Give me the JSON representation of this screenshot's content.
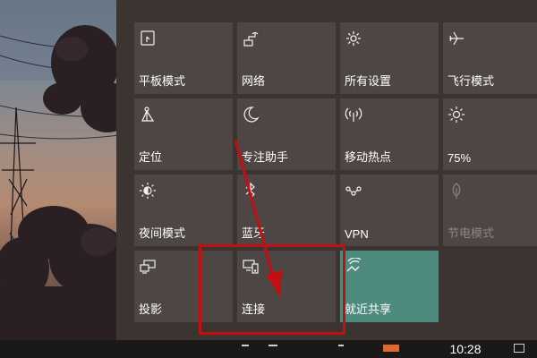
{
  "quick_actions": [
    {
      "key": "tablet",
      "label": "平板模式",
      "icon": "tablet-mode-icon",
      "state": "normal"
    },
    {
      "key": "network",
      "label": "网络",
      "icon": "network-icon",
      "state": "normal"
    },
    {
      "key": "settings",
      "label": "所有设置",
      "icon": "gear-icon",
      "state": "normal"
    },
    {
      "key": "airplane",
      "label": "飞行模式",
      "icon": "airplane-icon",
      "state": "normal"
    },
    {
      "key": "location",
      "label": "定位",
      "icon": "location-icon",
      "state": "normal"
    },
    {
      "key": "focus",
      "label": "专注助手",
      "icon": "moon-icon",
      "state": "normal"
    },
    {
      "key": "hotspot",
      "label": "移动热点",
      "icon": "hotspot-icon",
      "state": "normal"
    },
    {
      "key": "brightness",
      "label": "75%",
      "icon": "brightness-icon",
      "state": "normal"
    },
    {
      "key": "nightlight",
      "label": "夜间模式",
      "icon": "night-light-icon",
      "state": "normal"
    },
    {
      "key": "bluetooth",
      "label": "蓝牙",
      "icon": "bluetooth-icon",
      "state": "normal"
    },
    {
      "key": "vpn",
      "label": "VPN",
      "icon": "vpn-icon",
      "state": "normal"
    },
    {
      "key": "battery_saver",
      "label": "节电模式",
      "icon": "battery-saver-icon",
      "state": "disabled"
    },
    {
      "key": "project",
      "label": "投影",
      "icon": "project-icon",
      "state": "normal"
    },
    {
      "key": "connect",
      "label": "连接",
      "icon": "connect-icon",
      "state": "normal"
    },
    {
      "key": "nearby_sharing",
      "label": "就近共享",
      "icon": "nearby-sharing-icon",
      "state": "active"
    }
  ],
  "taskbar": {
    "clock": "10:28"
  },
  "colors": {
    "panel_bg": "#3b3431",
    "tile_bg": "#4d4644",
    "accent_tile": "#4e8a7d",
    "annotation_red": "#c40f12"
  }
}
